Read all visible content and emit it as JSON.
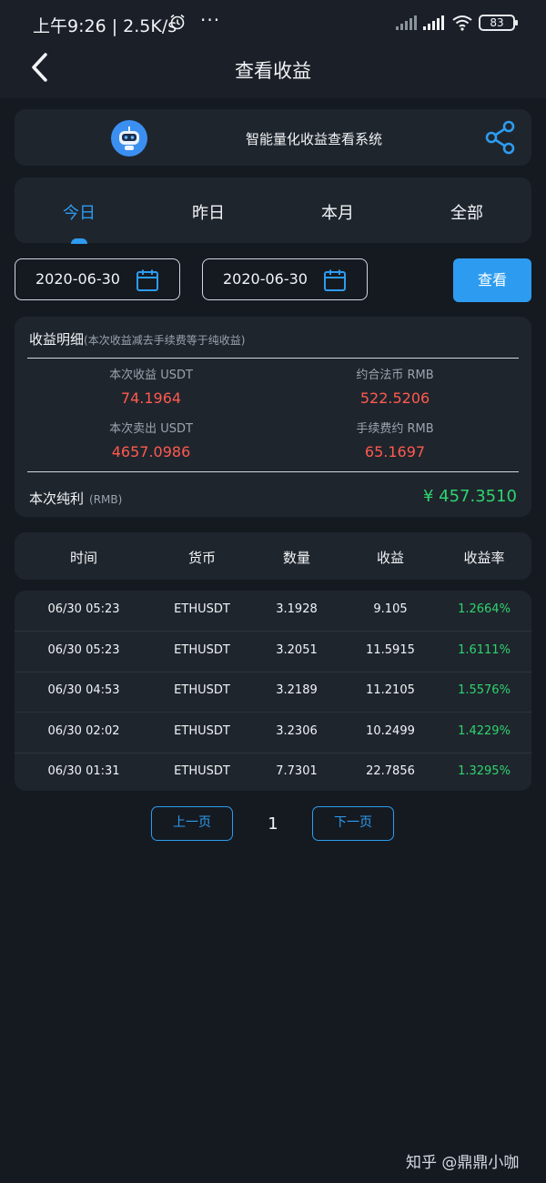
{
  "status_bar": {
    "time": "上午9:26 | 2.5K/s",
    "more": "···",
    "battery": "83",
    "icons": [
      "alarm-icon",
      "signal-icon",
      "wifi-icon",
      "battery-icon"
    ]
  },
  "header": {
    "title": "查看收益",
    "back_icon": "chevron-left-icon"
  },
  "system_card": {
    "title": "智能量化收益查看系统",
    "logo_icon": "robot-icon",
    "share_icon": "share-icon"
  },
  "tabs": [
    {
      "label": "今日",
      "active": true
    },
    {
      "label": "昨日",
      "active": false
    },
    {
      "label": "本月",
      "active": false
    },
    {
      "label": "全部",
      "active": false
    }
  ],
  "date_filter": {
    "start": "2020-06-30",
    "end": "2020-06-30",
    "calendar_icon": "calendar-icon",
    "view_label": "查看"
  },
  "detail": {
    "heading": "收益明细",
    "note": "(本次收益减去手续费等于纯收益)",
    "metrics": [
      {
        "label": "本次收益 USDT",
        "value": "74.1964"
      },
      {
        "label": "约合法币 RMB",
        "value": "522.5206"
      },
      {
        "label": "本次卖出 USDT",
        "value": "4657.0986"
      },
      {
        "label": "手续费约 RMB",
        "value": "65.1697"
      }
    ],
    "net_label": "本次纯利",
    "net_unit": "(RMB)",
    "net_value": "¥ 457.3510"
  },
  "table": {
    "headers": [
      "时间",
      "货币",
      "数量",
      "收益",
      "收益率"
    ],
    "rows": [
      [
        "06/30 05:23",
        "ETHUSDT",
        "3.1928",
        "9.105",
        "1.2664%"
      ],
      [
        "06/30 05:23",
        "ETHUSDT",
        "3.2051",
        "11.5915",
        "1.6111%"
      ],
      [
        "06/30 04:53",
        "ETHUSDT",
        "3.2189",
        "11.2105",
        "1.5576%"
      ],
      [
        "06/30 02:02",
        "ETHUSDT",
        "3.2306",
        "10.2499",
        "1.4229%"
      ],
      [
        "06/30 01:31",
        "ETHUSDT",
        "7.7301",
        "22.7856",
        "1.3295%"
      ]
    ]
  },
  "pagination": {
    "prev_label": "上一页",
    "page": "1",
    "next_label": "下一页"
  },
  "watermark": "知乎 @鼎鼎小咖",
  "colors": {
    "background": "#151a21",
    "card": "#1f252d",
    "accent": "#2d9cf0",
    "loss_red": "#ff5a4f",
    "gain_green": "#2ed46e"
  }
}
